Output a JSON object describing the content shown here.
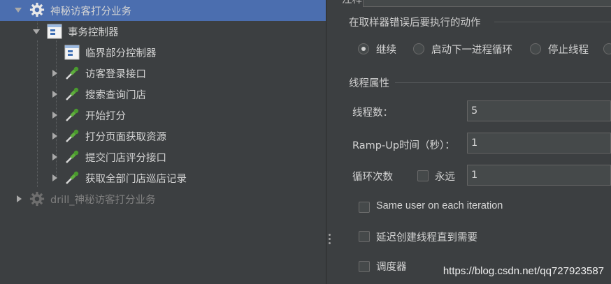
{
  "tree": {
    "items": [
      {
        "label": "神秘访客打分业务",
        "icon": "gear-icon"
      },
      {
        "label": "事务控制器",
        "icon": "transaction-controller-icon"
      },
      {
        "label": "临界部分控制器",
        "icon": "critical-section-controller-icon"
      },
      {
        "label": "访客登录接口",
        "icon": "pipette-sampler-icon"
      },
      {
        "label": "搜索查询门店",
        "icon": "pipette-sampler-icon"
      },
      {
        "label": "开始打分",
        "icon": "pipette-sampler-icon"
      },
      {
        "label": "打分页面获取资源",
        "icon": "pipette-sampler-icon"
      },
      {
        "label": "提交门店评分接口",
        "icon": "pipette-sampler-icon"
      },
      {
        "label": "获取全部门店巡店记录",
        "icon": "pipette-sampler-icon"
      },
      {
        "label": "drill_神秘访客打分业务",
        "icon": "gear-icon"
      }
    ]
  },
  "panel": {
    "partial_label": "注释",
    "error_action": {
      "title": "在取样器错误后要执行的动作",
      "options": [
        "继续",
        "启动下一进程循环",
        "停止线程"
      ],
      "selected": "继续"
    },
    "thread_props": {
      "title": "线程属性",
      "threads_label": "线程数：",
      "threads_value": "5",
      "rampup_label": "Ramp-Up时间（秒）：",
      "rampup_value": "1",
      "loop_label": "循环次数",
      "forever_label": "永远",
      "loop_value": "1",
      "same_user_label": "Same user on each iteration",
      "delay_label": "延迟创建线程直到需要",
      "scheduler_label": "调度器"
    }
  },
  "watermark": "https://blog.csdn.net/qq727923587",
  "colors": {
    "background": "#3c3f41",
    "selection": "#4b6eaf",
    "text": "#d4d4d4",
    "disabled_text": "#7f7f7f"
  }
}
